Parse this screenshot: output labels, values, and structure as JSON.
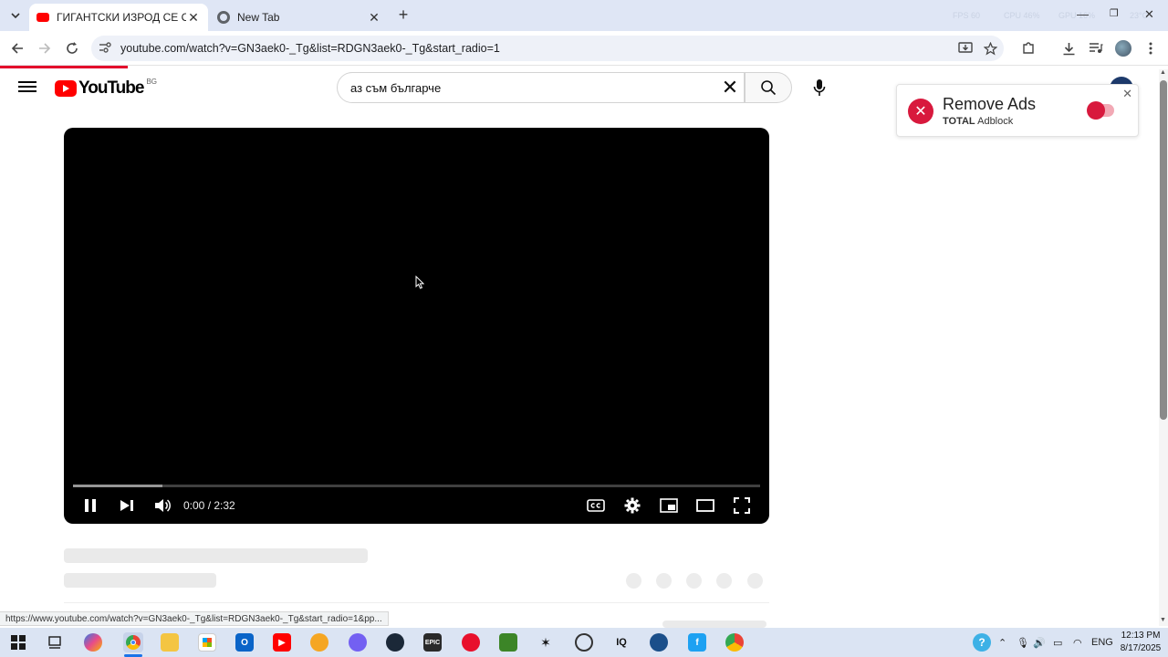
{
  "browser": {
    "tabs": [
      {
        "title": "ГИГАНТСКИ ИЗРОД СЕ ОПИТ",
        "favicon_color": "#ff0000",
        "active": true
      },
      {
        "title": "New Tab",
        "favicon_color": "#5f6368",
        "active": false
      }
    ],
    "new_tab_glyph": "+",
    "sys_stats": [
      "FPS 60",
      "CPU 46%",
      "GPU 16%",
      "23°C"
    ],
    "url": "youtube.com/watch?v=GN3aek0-_Tg&list=RDGN3aek0-_Tg&start_radio=1",
    "status_url": "https://www.youtube.com/watch?v=GN3aek0-_Tg&list=RDGN3aek0-_Tg&start_radio=1&pp..."
  },
  "youtube": {
    "logo_text": "YouTube",
    "country_code": "BG",
    "search_query": "аз съм българче",
    "accent": "#ff0000"
  },
  "ad_popup": {
    "title": "Remove Ads",
    "brand_bold": "TOTAL",
    "brand_rest": "Adblock",
    "accent": "#d8193d"
  },
  "player": {
    "time": "0:00 / 2:32",
    "buffered_fraction": 0.13
  },
  "taskbar": {
    "language": "ENG",
    "time": "12:13 PM",
    "date": "8/17/2025"
  }
}
